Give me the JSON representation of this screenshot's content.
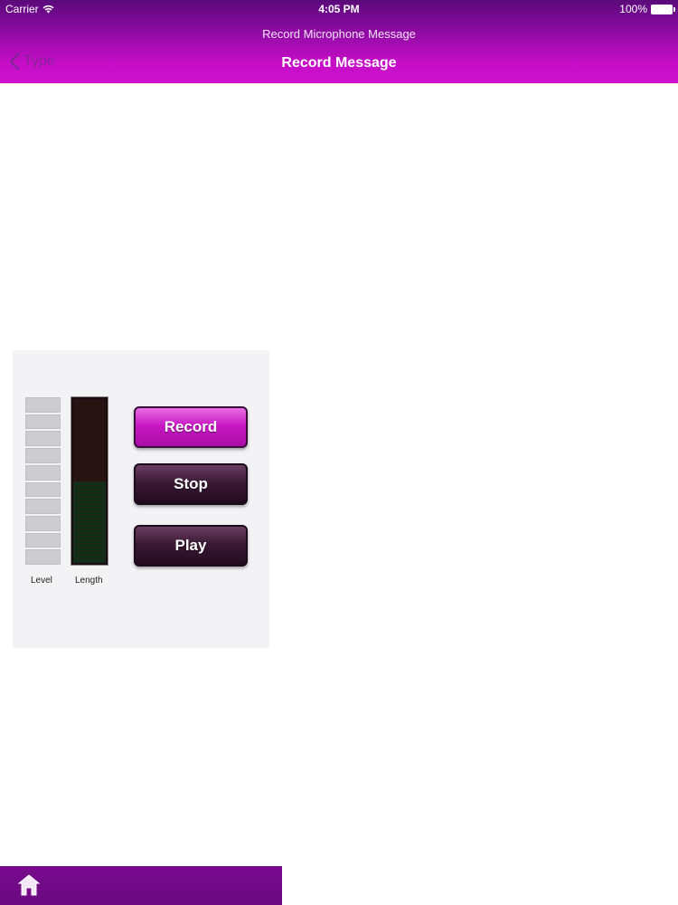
{
  "status_bar": {
    "carrier": "Carrier",
    "time": "4:05 PM",
    "battery": "100%"
  },
  "nav": {
    "subtitle": "Record Microphone Message",
    "title": "Record Message",
    "back_label": "Type"
  },
  "recorder": {
    "level_label": "Level",
    "length_label": "Length",
    "record_label": "Record",
    "stop_label": "Stop",
    "play_label": "Play"
  },
  "icons": {
    "wifi": "wifi-icon",
    "battery": "battery-icon",
    "back": "chevron-left-icon",
    "home": "home-icon"
  },
  "colors": {
    "accent": "#c010c4",
    "nav_top": "#5a0a7a",
    "button_dark": "#2a1026"
  }
}
